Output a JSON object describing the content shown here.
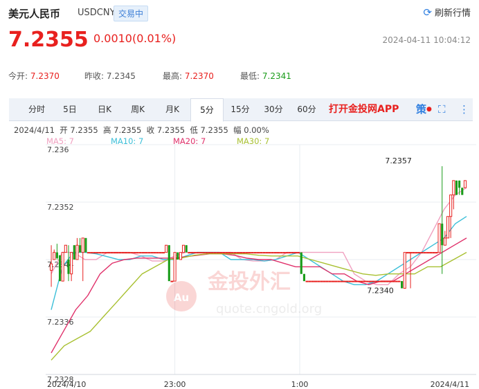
{
  "header": {
    "title": "美元人民币",
    "code": "USDCNY",
    "status": "交易中",
    "refresh_label": "刷新行情",
    "price": "7.2355",
    "change": "0.0010(0.01%)",
    "datetime": "2024-04-11 10:04:12"
  },
  "stats": {
    "open_label": "今开:",
    "open": "7.2370",
    "prev_label": "昨收:",
    "prev": "7.2345",
    "high_label": "最高:",
    "high": "7.2370",
    "low_label": "最低:",
    "low": "7.2341"
  },
  "toolbar": {
    "tabs": [
      "分时",
      "5日",
      "日K",
      "周K",
      "月K",
      "5分",
      "15分",
      "30分",
      "60分"
    ],
    "active": "5分",
    "app_link": "打开金投网APP",
    "strategy_label": "策"
  },
  "bar_info": "2024/4/11  开 7.2355  高 7.2355  收 7.2355  低 7.2355  幅 0.00%",
  "ma_legend": {
    "ma5": "MA5: 7",
    "ma10": "MA10: 7",
    "ma20": "MA20: 7",
    "ma30": "MA30: 7"
  },
  "watermark": {
    "brand": "金投外汇",
    "url": "quote.cngold.org"
  },
  "colors": {
    "up": "#e8201e",
    "down": "#1a9c1a",
    "ma5": "#f0a0c0",
    "ma10": "#3bbfd8",
    "ma20": "#e0306a",
    "ma30": "#a8c030"
  },
  "chart_data": {
    "type": "candlestick",
    "y_ticks": [
      "7.236",
      "7.2352",
      "7.2344",
      "7.2336",
      "7.2328"
    ],
    "ylim": [
      7.2328,
      7.236
    ],
    "x_ticks": [
      "2024/4/10",
      "23:00",
      "1:00",
      "2024/4/11"
    ],
    "annotations": [
      {
        "text": "7.2357",
        "x": 0.86,
        "value": 7.2357
      },
      {
        "text": "7.2340",
        "x": 0.74,
        "value": 7.23405
      }
    ],
    "candles": [
      {
        "o": 7.23425,
        "h": 7.2346,
        "l": 7.23402,
        "c": 7.23434
      },
      {
        "o": 7.2344,
        "h": 7.23454,
        "l": 7.2344,
        "c": 7.2345
      },
      {
        "o": 7.2345,
        "h": 7.23462,
        "l": 7.2344,
        "c": 7.23442
      },
      {
        "o": 7.23446,
        "h": 7.23446,
        "l": 7.2341,
        "c": 7.2341
      },
      {
        "o": 7.2341,
        "h": 7.2345,
        "l": 7.2341,
        "c": 7.2345
      },
      {
        "o": 7.2345,
        "h": 7.2346,
        "l": 7.2345,
        "c": 7.2346
      },
      {
        "o": 7.2344,
        "h": 7.2346,
        "l": 7.2341,
        "c": 7.2342
      },
      {
        "o": 7.2342,
        "h": 7.2345,
        "l": 7.2341,
        "c": 7.2345
      },
      {
        "o": 7.2346,
        "h": 7.2346,
        "l": 7.2344,
        "c": 7.2344
      },
      {
        "o": 7.2344,
        "h": 7.2347,
        "l": 7.2344,
        "c": 7.2346
      },
      {
        "o": 7.2346,
        "h": 7.2347,
        "l": 7.2345,
        "c": 7.2345
      },
      {
        "o": 7.2345,
        "h": 7.2347,
        "l": 7.2341,
        "c": 7.2347
      },
      {
        "o": 7.2347,
        "h": 7.2347,
        "l": 7.2345,
        "c": 7.2345
      },
      {
        "o": 7.2345,
        "h": 7.2345,
        "l": 7.2345,
        "c": 7.2345
      },
      {
        "o": 7.2345,
        "h": 7.2345,
        "l": 7.2345,
        "c": 7.2345
      },
      {
        "o": 7.2345,
        "h": 7.2345,
        "l": 7.2345,
        "c": 7.2345
      },
      {
        "o": 7.2345,
        "h": 7.2345,
        "l": 7.2345,
        "c": 7.2345
      },
      {
        "o": 7.2345,
        "h": 7.2345,
        "l": 7.2345,
        "c": 7.2345
      },
      {
        "o": 7.2345,
        "h": 7.2345,
        "l": 7.2345,
        "c": 7.2345
      },
      {
        "o": 7.2345,
        "h": 7.2345,
        "l": 7.2345,
        "c": 7.2345
      },
      {
        "o": 7.2345,
        "h": 7.2345,
        "l": 7.2345,
        "c": 7.2345
      },
      {
        "o": 7.2345,
        "h": 7.2345,
        "l": 7.2345,
        "c": 7.2345
      },
      {
        "o": 7.2345,
        "h": 7.2345,
        "l": 7.2345,
        "c": 7.2345
      },
      {
        "o": 7.2345,
        "h": 7.2345,
        "l": 7.2345,
        "c": 7.2345
      },
      {
        "o": 7.2345,
        "h": 7.2345,
        "l": 7.2345,
        "c": 7.2345
      },
      {
        "o": 7.2345,
        "h": 7.2345,
        "l": 7.2345,
        "c": 7.2345
      },
      {
        "o": 7.2345,
        "h": 7.2345,
        "l": 7.2345,
        "c": 7.2345
      },
      {
        "o": 7.2345,
        "h": 7.2345,
        "l": 7.2345,
        "c": 7.2345
      },
      {
        "o": 7.2345,
        "h": 7.2345,
        "l": 7.2345,
        "c": 7.2345
      },
      {
        "o": 7.2345,
        "h": 7.2345,
        "l": 7.2345,
        "c": 7.2345
      },
      {
        "o": 7.2345,
        "h": 7.2345,
        "l": 7.2345,
        "c": 7.2345
      },
      {
        "o": 7.2345,
        "h": 7.2345,
        "l": 7.2345,
        "c": 7.2345
      },
      {
        "o": 7.2345,
        "h": 7.2345,
        "l": 7.2345,
        "c": 7.2345
      },
      {
        "o": 7.2345,
        "h": 7.2345,
        "l": 7.2345,
        "c": 7.2345
      },
      {
        "o": 7.2345,
        "h": 7.2345,
        "l": 7.2345,
        "c": 7.2345
      },
      {
        "o": 7.2345,
        "h": 7.2345,
        "l": 7.2345,
        "c": 7.2345
      },
      {
        "o": 7.2345,
        "h": 7.2345,
        "l": 7.2345,
        "c": 7.2345
      },
      {
        "o": 7.2345,
        "h": 7.2345,
        "l": 7.2345,
        "c": 7.2345
      },
      {
        "o": 7.2345,
        "h": 7.2345,
        "l": 7.2345,
        "c": 7.2345
      },
      {
        "o": 7.2345,
        "h": 7.2345,
        "l": 7.2345,
        "c": 7.2345
      },
      {
        "o": 7.2345,
        "h": 7.2346,
        "l": 7.2345,
        "c": 7.2346
      },
      {
        "o": 7.2346,
        "h": 7.2346,
        "l": 7.2341,
        "c": 7.2341
      },
      {
        "o": 7.2341,
        "h": 7.2341,
        "l": 7.2341,
        "c": 7.2341
      },
      {
        "o": 7.2341,
        "h": 7.2345,
        "l": 7.2341,
        "c": 7.2345
      },
      {
        "o": 7.2345,
        "h": 7.2345,
        "l": 7.2344,
        "c": 7.2344
      },
      {
        "o": 7.2344,
        "h": 7.2345,
        "l": 7.2344,
        "c": 7.2345
      },
      {
        "o": 7.2345,
        "h": 7.2346,
        "l": 7.2345,
        "c": 7.2346
      },
      {
        "o": 7.2346,
        "h": 7.2346,
        "l": 7.2345,
        "c": 7.2345
      },
      {
        "o": 7.2345,
        "h": 7.2345,
        "l": 7.2345,
        "c": 7.2345
      },
      {
        "o": 7.2345,
        "h": 7.2345,
        "l": 7.2345,
        "c": 7.2345
      },
      {
        "o": 7.2345,
        "h": 7.2345,
        "l": 7.2345,
        "c": 7.2345
      },
      {
        "o": 7.2345,
        "h": 7.2345,
        "l": 7.2345,
        "c": 7.2345
      },
      {
        "o": 7.2345,
        "h": 7.2345,
        "l": 7.2345,
        "c": 7.2345
      },
      {
        "o": 7.2345,
        "h": 7.2345,
        "l": 7.2345,
        "c": 7.2345
      },
      {
        "o": 7.2345,
        "h": 7.2345,
        "l": 7.2345,
        "c": 7.2345
      },
      {
        "o": 7.2345,
        "h": 7.2345,
        "l": 7.2345,
        "c": 7.2345
      },
      {
        "o": 7.2345,
        "h": 7.2345,
        "l": 7.2345,
        "c": 7.2345
      },
      {
        "o": 7.2345,
        "h": 7.2345,
        "l": 7.2345,
        "c": 7.2345
      },
      {
        "o": 7.2345,
        "h": 7.2345,
        "l": 7.2345,
        "c": 7.2345
      },
      {
        "o": 7.2345,
        "h": 7.2345,
        "l": 7.2345,
        "c": 7.2345
      },
      {
        "o": 7.2345,
        "h": 7.2345,
        "l": 7.2345,
        "c": 7.2345
      },
      {
        "o": 7.2345,
        "h": 7.2345,
        "l": 7.2345,
        "c": 7.2345
      },
      {
        "o": 7.2345,
        "h": 7.2345,
        "l": 7.2345,
        "c": 7.2345
      },
      {
        "o": 7.2345,
        "h": 7.2345,
        "l": 7.2345,
        "c": 7.2345
      },
      {
        "o": 7.2345,
        "h": 7.2345,
        "l": 7.2345,
        "c": 7.2345
      },
      {
        "o": 7.2345,
        "h": 7.2345,
        "l": 7.2345,
        "c": 7.2345
      },
      {
        "o": 7.2345,
        "h": 7.2345,
        "l": 7.2345,
        "c": 7.2345
      },
      {
        "o": 7.2345,
        "h": 7.2345,
        "l": 7.2345,
        "c": 7.2345
      },
      {
        "o": 7.2345,
        "h": 7.2345,
        "l": 7.2345,
        "c": 7.2345
      },
      {
        "o": 7.2345,
        "h": 7.2345,
        "l": 7.2345,
        "c": 7.2345
      },
      {
        "o": 7.2345,
        "h": 7.2345,
        "l": 7.2345,
        "c": 7.2345
      },
      {
        "o": 7.2345,
        "h": 7.2345,
        "l": 7.2345,
        "c": 7.2345
      },
      {
        "o": 7.2345,
        "h": 7.2345,
        "l": 7.2345,
        "c": 7.2345
      },
      {
        "o": 7.2345,
        "h": 7.2345,
        "l": 7.2345,
        "c": 7.2345
      },
      {
        "o": 7.2345,
        "h": 7.2345,
        "l": 7.2345,
        "c": 7.2345
      },
      {
        "o": 7.2345,
        "h": 7.2345,
        "l": 7.2345,
        "c": 7.2345
      },
      {
        "o": 7.2345,
        "h": 7.2345,
        "l": 7.2345,
        "c": 7.2345
      },
      {
        "o": 7.2345,
        "h": 7.2345,
        "l": 7.2345,
        "c": 7.2345
      },
      {
        "o": 7.2345,
        "h": 7.2345,
        "l": 7.2345,
        "c": 7.2345
      },
      {
        "o": 7.2345,
        "h": 7.2345,
        "l": 7.2345,
        "c": 7.2345
      },
      {
        "o": 7.2345,
        "h": 7.2345,
        "l": 7.2345,
        "c": 7.2345
      },
      {
        "o": 7.2345,
        "h": 7.2345,
        "l": 7.2345,
        "c": 7.2345
      },
      {
        "o": 7.2345,
        "h": 7.2345,
        "l": 7.2345,
        "c": 7.2345
      },
      {
        "o": 7.2345,
        "h": 7.2345,
        "l": 7.2345,
        "c": 7.2345
      },
      {
        "o": 7.2345,
        "h": 7.2345,
        "l": 7.2345,
        "c": 7.2345
      },
      {
        "o": 7.2345,
        "h": 7.2345,
        "l": 7.2345,
        "c": 7.2345
      },
      {
        "o": 7.2345,
        "h": 7.2345,
        "l": 7.2345,
        "c": 7.2345
      },
      {
        "o": 7.2345,
        "h": 7.2345,
        "l": 7.2342,
        "c": 7.2342
      },
      {
        "o": 7.2342,
        "h": 7.2342,
        "l": 7.2341,
        "c": 7.2341
      },
      {
        "o": 7.2341,
        "h": 7.2341,
        "l": 7.2341,
        "c": 7.2341
      },
      {
        "o": 7.2341,
        "h": 7.2341,
        "l": 7.2341,
        "c": 7.2341
      },
      {
        "o": 7.2341,
        "h": 7.2341,
        "l": 7.2341,
        "c": 7.2341
      },
      {
        "o": 7.2341,
        "h": 7.2341,
        "l": 7.2341,
        "c": 7.2341
      },
      {
        "o": 7.2341,
        "h": 7.2341,
        "l": 7.2341,
        "c": 7.2341
      },
      {
        "o": 7.2341,
        "h": 7.2341,
        "l": 7.2341,
        "c": 7.2341
      },
      {
        "o": 7.2341,
        "h": 7.2341,
        "l": 7.2341,
        "c": 7.2341
      },
      {
        "o": 7.2341,
        "h": 7.2341,
        "l": 7.2341,
        "c": 7.2341
      },
      {
        "o": 7.2341,
        "h": 7.2341,
        "l": 7.2341,
        "c": 7.2341
      },
      {
        "o": 7.2341,
        "h": 7.2341,
        "l": 7.2341,
        "c": 7.2341
      },
      {
        "o": 7.2341,
        "h": 7.2341,
        "l": 7.2341,
        "c": 7.2341
      },
      {
        "o": 7.2341,
        "h": 7.2341,
        "l": 7.2341,
        "c": 7.2341
      },
      {
        "o": 7.2341,
        "h": 7.2341,
        "l": 7.2341,
        "c": 7.2341
      },
      {
        "o": 7.2341,
        "h": 7.2341,
        "l": 7.2341,
        "c": 7.2341
      },
      {
        "o": 7.2341,
        "h": 7.2341,
        "l": 7.2341,
        "c": 7.2341
      },
      {
        "o": 7.2341,
        "h": 7.2341,
        "l": 7.2341,
        "c": 7.2341
      },
      {
        "o": 7.2341,
        "h": 7.2341,
        "l": 7.2341,
        "c": 7.2341
      },
      {
        "o": 7.2341,
        "h": 7.2341,
        "l": 7.2341,
        "c": 7.2341
      },
      {
        "o": 7.2341,
        "h": 7.2341,
        "l": 7.2341,
        "c": 7.2341
      },
      {
        "o": 7.2341,
        "h": 7.2341,
        "l": 7.2341,
        "c": 7.2341
      },
      {
        "o": 7.2341,
        "h": 7.2341,
        "l": 7.2341,
        "c": 7.2341
      },
      {
        "o": 7.2341,
        "h": 7.2341,
        "l": 7.2341,
        "c": 7.2341
      },
      {
        "o": 7.2341,
        "h": 7.2341,
        "l": 7.2341,
        "c": 7.2341
      },
      {
        "o": 7.2341,
        "h": 7.2341,
        "l": 7.2341,
        "c": 7.2341
      },
      {
        "o": 7.2341,
        "h": 7.2341,
        "l": 7.2341,
        "c": 7.2341
      },
      {
        "o": 7.2341,
        "h": 7.2341,
        "l": 7.2341,
        "c": 7.2341
      },
      {
        "o": 7.2341,
        "h": 7.2341,
        "l": 7.2341,
        "c": 7.2341
      },
      {
        "o": 7.2341,
        "h": 7.2341,
        "l": 7.2341,
        "c": 7.2341
      },
      {
        "o": 7.2341,
        "h": 7.2341,
        "l": 7.2341,
        "c": 7.2341
      },
      {
        "o": 7.2341,
        "h": 7.2341,
        "l": 7.2341,
        "c": 7.2341
      },
      {
        "o": 7.2341,
        "h": 7.2341,
        "l": 7.2341,
        "c": 7.2341
      },
      {
        "o": 7.2341,
        "h": 7.2341,
        "l": 7.2341,
        "c": 7.2341
      },
      {
        "o": 7.2341,
        "h": 7.2341,
        "l": 7.2341,
        "c": 7.2341
      },
      {
        "o": 7.2341,
        "h": 7.2341,
        "l": 7.234,
        "c": 7.234
      },
      {
        "o": 7.234,
        "h": 7.2345,
        "l": 7.234,
        "c": 7.2345
      },
      {
        "o": 7.2345,
        "h": 7.2345,
        "l": 7.2345,
        "c": 7.2345
      },
      {
        "o": 7.2345,
        "h": 7.2345,
        "l": 7.234,
        "c": 7.2345
      },
      {
        "o": 7.2345,
        "h": 7.2345,
        "l": 7.2345,
        "c": 7.2345
      },
      {
        "o": 7.2345,
        "h": 7.2345,
        "l": 7.2345,
        "c": 7.2345
      },
      {
        "o": 7.2345,
        "h": 7.2345,
        "l": 7.2345,
        "c": 7.2345
      },
      {
        "o": 7.2345,
        "h": 7.2345,
        "l": 7.2345,
        "c": 7.2345
      },
      {
        "o": 7.2345,
        "h": 7.2345,
        "l": 7.2345,
        "c": 7.2345
      },
      {
        "o": 7.2345,
        "h": 7.2345,
        "l": 7.2345,
        "c": 7.2345
      },
      {
        "o": 7.2345,
        "h": 7.2345,
        "l": 7.2345,
        "c": 7.2345
      },
      {
        "o": 7.2345,
        "h": 7.2345,
        "l": 7.2345,
        "c": 7.2345
      },
      {
        "o": 7.2345,
        "h": 7.2345,
        "l": 7.2345,
        "c": 7.2345
      },
      {
        "o": 7.2345,
        "h": 7.2349,
        "l": 7.2345,
        "c": 7.2349
      },
      {
        "o": 7.2349,
        "h": 7.2357,
        "l": 7.2342,
        "c": 7.2346
      },
      {
        "o": 7.2346,
        "h": 7.2348,
        "l": 7.2346,
        "c": 7.2347
      },
      {
        "o": 7.2347,
        "h": 7.235,
        "l": 7.2347,
        "c": 7.235
      },
      {
        "o": 7.235,
        "h": 7.2353,
        "l": 7.2347,
        "c": 7.2353
      },
      {
        "o": 7.2353,
        "h": 7.2355,
        "l": 7.2351,
        "c": 7.2355
      },
      {
        "o": 7.2355,
        "h": 7.2355,
        "l": 7.2353,
        "c": 7.2353
      },
      {
        "o": 7.2355,
        "h": 7.2355,
        "l": 7.2353,
        "c": 7.2354
      },
      {
        "o": 7.2354,
        "h": 7.2354,
        "l": 7.2353,
        "c": 7.2353
      },
      {
        "o": 7.2354,
        "h": 7.2355,
        "l": 7.2354,
        "c": 7.2355
      }
    ],
    "ma_series": {
      "MA5": [
        7.2342,
        7.2345,
        7.2345,
        7.2344,
        7.2344,
        7.2345,
        7.2345,
        7.2345,
        7.23445,
        7.23438,
        7.23438,
        7.23445,
        7.2345,
        7.2345,
        7.2345,
        7.2345,
        7.2345,
        7.2344,
        7.23438,
        7.23438,
        7.2344,
        7.2345,
        7.2345,
        7.2345,
        7.2345,
        7.2345,
        7.2345,
        7.2342,
        7.2341,
        7.23405,
        7.23405,
        7.2342,
        7.2343,
        7.2345,
        7.2348,
        7.2351,
        7.2353,
        7.2354
      ],
      "MA10": [
        7.2337,
        7.2343,
        7.2345,
        7.2345,
        7.23448,
        7.23444,
        7.2344,
        7.2344,
        7.23445,
        7.23445,
        7.2344,
        7.2344,
        7.23445,
        7.2345,
        7.2345,
        7.2345,
        7.2344,
        7.2344,
        7.2344,
        7.23438,
        7.2344,
        7.23445,
        7.2345,
        7.2344,
        7.2343,
        7.2342,
        7.2341,
        7.23405,
        7.23405,
        7.2341,
        7.2342,
        7.2343,
        7.2344,
        7.2345,
        7.2346,
        7.2347,
        7.2349,
        7.235
      ],
      "MA20": [
        7.2331,
        7.2334,
        7.2337,
        7.2339,
        7.2342,
        7.23435,
        7.2344,
        7.23442,
        7.23442,
        7.23442,
        7.23442,
        7.23444,
        7.23446,
        7.23448,
        7.23448,
        7.23446,
        7.23442,
        7.2344,
        7.2344,
        7.23435,
        7.2343,
        7.2343,
        7.2343,
        7.2342,
        7.2342,
        7.2341,
        7.23405,
        7.2341,
        7.2341,
        7.2342,
        7.2343,
        7.2344,
        7.2345,
        7.2346,
        7.2347
      ],
      "MA30": [
        7.233,
        7.2332,
        7.2333,
        7.2334,
        7.2336,
        7.2338,
        7.234,
        7.2342,
        7.2343,
        7.2344,
        7.23442,
        7.23446,
        7.23448,
        7.23448,
        7.23448,
        7.23448,
        7.23446,
        7.23445,
        7.23445,
        7.23445,
        7.2344,
        7.23435,
        7.2343,
        7.23425,
        7.2342,
        7.23418,
        7.2342,
        7.2342,
        7.2342,
        7.2343,
        7.2343,
        7.2344,
        7.2345
      ]
    }
  }
}
